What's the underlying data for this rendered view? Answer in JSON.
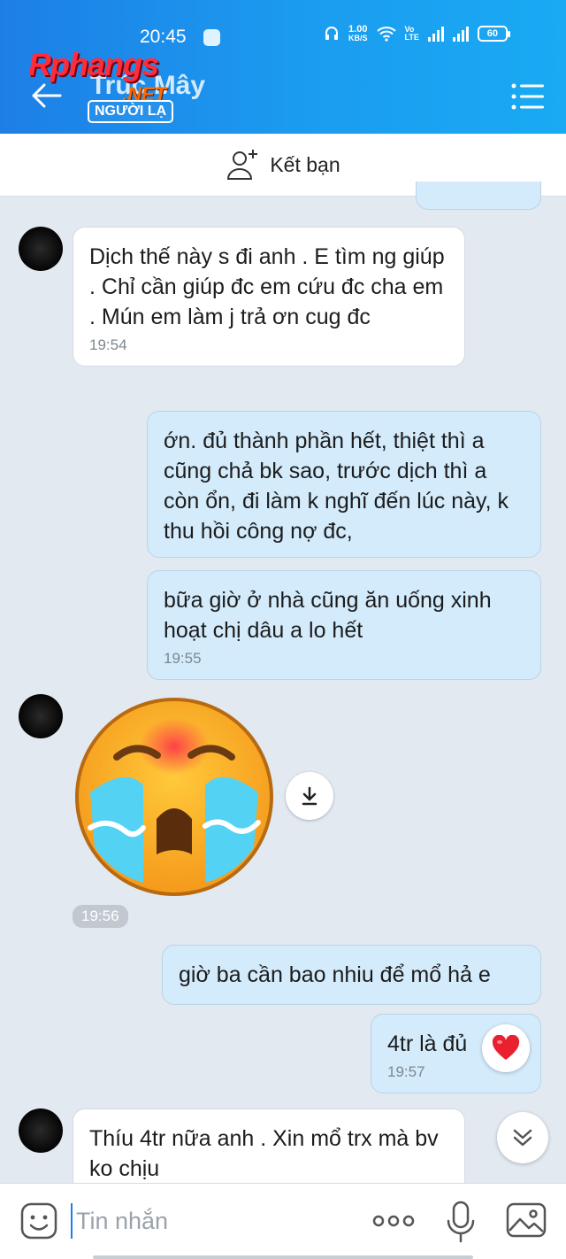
{
  "status_bar": {
    "time": "20:45",
    "net_speed_value": "1.00",
    "net_speed_unit": "KB/S",
    "volte_top": "Vo",
    "volte_bottom": "LTE",
    "battery": "60"
  },
  "header": {
    "contact_name": "Trúc Mây",
    "badge": "NGƯỜI LẠ",
    "watermark_main": "Rphangs",
    "watermark_sub": ".NET"
  },
  "friend_bar": {
    "label": "Kết bạn"
  },
  "messages": [
    {
      "direction": "in",
      "text": "Dịch thế này s đi anh . E tìm ng giúp . Chỉ cần giúp đc em cứu đc cha em . Mún em làm j trả ơn cug đc",
      "time": "19:54"
    },
    {
      "direction": "out",
      "text": "ớn. đủ thành phần hết, thiệt thì a cũng chả bk sao, trước dịch thì a còn ổn, đi làm k nghĩ đến lúc này, k thu hồi công nợ đc,"
    },
    {
      "direction": "out",
      "text": "bữa giờ ở nhà cũng ăn uống xinh hoạt chị dâu a lo hết",
      "time": "19:55"
    },
    {
      "direction": "in",
      "type": "sticker",
      "sticker": "crying-face",
      "time": "19:56"
    },
    {
      "direction": "out",
      "text": "giờ ba cần bao nhiu để mổ hả e"
    },
    {
      "direction": "out",
      "text": "4tr là đủ",
      "time": "19:57",
      "reaction": "heart"
    },
    {
      "direction": "in",
      "text": "Thíu 4tr nữa anh . Xin mổ trx mà bv ko chịu"
    }
  ],
  "input_bar": {
    "placeholder": "Tin nhắn"
  },
  "colors": {
    "header_start": "#1d7fe6",
    "header_end": "#19aaf3",
    "chat_bg": "#e2e9f1",
    "outgoing_bubble": "#d3ebfb",
    "incoming_bubble": "#ffffff"
  }
}
